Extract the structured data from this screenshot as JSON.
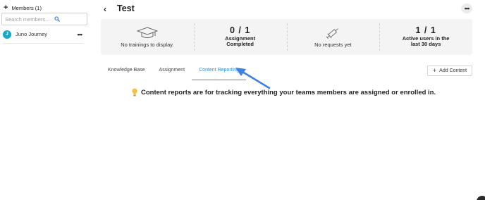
{
  "sidebar": {
    "members_title": "Members (1)",
    "search_placeholder": "Search members...",
    "members": [
      {
        "name": "Juno Journey",
        "avatar_color": "#16a8c4"
      }
    ]
  },
  "header": {
    "title": "Test",
    "more_label": "•••"
  },
  "stats": [
    {
      "icon": "graduation-cap-icon",
      "text": "No trainings to display."
    },
    {
      "value": "0 / 1",
      "label": "Assignment Completed"
    },
    {
      "icon": "syringe-icon",
      "text": "No requests yet"
    },
    {
      "value": "1 / 1",
      "label": "Active users in the last 30 days"
    }
  ],
  "tabs": [
    {
      "label": "Knowledge Base",
      "active": false
    },
    {
      "label": "Assignment",
      "active": false
    },
    {
      "label": "Content Reporting",
      "active": true
    }
  ],
  "add_content_label": "Add Content",
  "info_message": "Content reports are for tracking everything your teams members are assigned or enrolled in.",
  "colors": {
    "accent": "#2b8fe6",
    "stats_bg": "#f4f4f4",
    "bulb": "#f6c23e",
    "annotation_arrow": "#3d7fe0"
  }
}
